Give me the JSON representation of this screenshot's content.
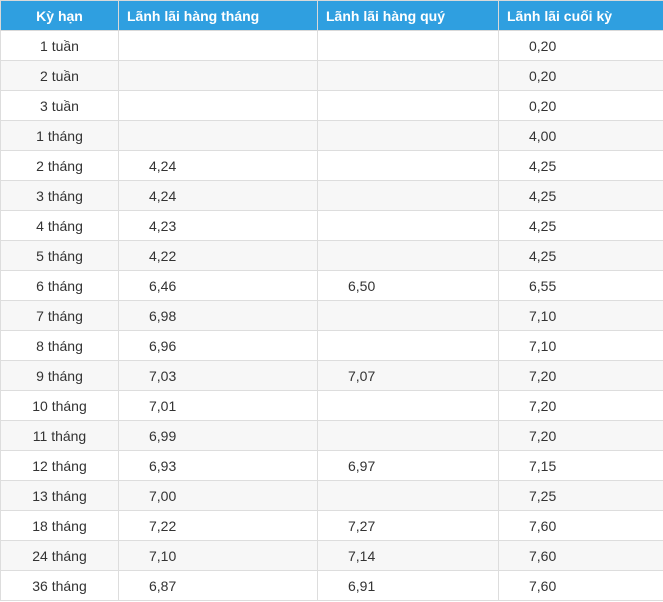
{
  "table": {
    "headers": [
      "Kỳ hạn",
      "Lãnh lãi hàng tháng",
      "Lãnh lãi hàng quý",
      "Lãnh lãi cuối kỳ"
    ],
    "rows": [
      [
        "1 tuần",
        "",
        "",
        "0,20"
      ],
      [
        "2 tuần",
        "",
        "",
        "0,20"
      ],
      [
        "3 tuần",
        "",
        "",
        "0,20"
      ],
      [
        "1 tháng",
        "",
        "",
        "4,00"
      ],
      [
        "2 tháng",
        "4,24",
        "",
        "4,25"
      ],
      [
        "3 tháng",
        "4,24",
        "",
        "4,25"
      ],
      [
        "4 tháng",
        "4,23",
        "",
        "4,25"
      ],
      [
        "5 tháng",
        "4,22",
        "",
        "4,25"
      ],
      [
        "6 tháng",
        "6,46",
        "6,50",
        "6,55"
      ],
      [
        "7 tháng",
        "6,98",
        "",
        "7,10"
      ],
      [
        "8 tháng",
        "6,96",
        "",
        "7,10"
      ],
      [
        "9 tháng",
        "7,03",
        "7,07",
        "7,20"
      ],
      [
        "10 tháng",
        "7,01",
        "",
        "7,20"
      ],
      [
        "11 tháng",
        "6,99",
        "",
        "7,20"
      ],
      [
        "12 tháng",
        "6,93",
        "6,97",
        "7,15"
      ],
      [
        "13 tháng",
        "7,00",
        "",
        "7,25"
      ],
      [
        "18 tháng",
        "7,22",
        "7,27",
        "7,60"
      ],
      [
        "24 tháng",
        "7,10",
        "7,14",
        "7,60"
      ],
      [
        "36 tháng",
        "6,87",
        "6,91",
        "7,60"
      ]
    ]
  },
  "colors": {
    "header_background": "#2f9fe0",
    "header_text": "#ffffff",
    "row_alt_background": "#f7f7f7",
    "border": "#dddddd"
  }
}
